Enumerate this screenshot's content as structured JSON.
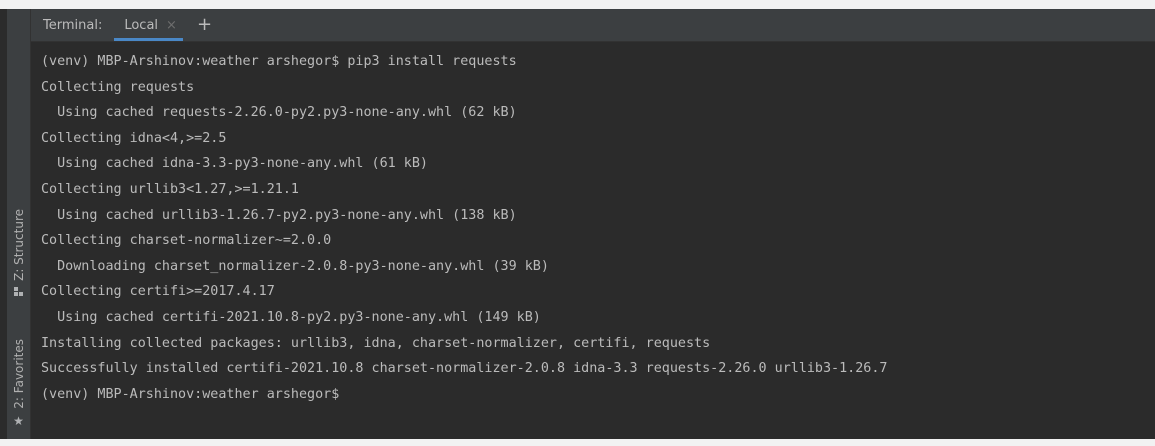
{
  "tabbar": {
    "title": "Terminal:",
    "active_tab": "Local",
    "close_glyph": "×",
    "add_glyph": "+"
  },
  "sidebar": {
    "structure_label": "Z: Structure",
    "favorites_label": "2: Favorites",
    "favorites_icon": "star-icon",
    "structure_icon": "structure-icon"
  },
  "terminal": {
    "lines": [
      "(venv) MBP-Arshinov:weather arshegor$ pip3 install requests",
      "Collecting requests",
      "  Using cached requests-2.26.0-py2.py3-none-any.whl (62 kB)",
      "Collecting idna<4,>=2.5",
      "  Using cached idna-3.3-py3-none-any.whl (61 kB)",
      "Collecting urllib3<1.27,>=1.21.1",
      "  Using cached urllib3-1.26.7-py2.py3-none-any.whl (138 kB)",
      "Collecting charset-normalizer~=2.0.0",
      "  Downloading charset_normalizer-2.0.8-py3-none-any.whl (39 kB)",
      "Collecting certifi>=2017.4.17",
      "  Using cached certifi-2021.10.8-py2.py3-none-any.whl (149 kB)",
      "Installing collected packages: urllib3, idna, charset-normalizer, certifi, requests",
      "Successfully installed certifi-2021.10.8 charset-normalizer-2.0.8 idna-3.3 requests-2.26.0 urllib3-1.26.7",
      "(venv) MBP-Arshinov:weather arshegor$"
    ]
  },
  "colors": {
    "background": "#2b2b2b",
    "panel": "#3c3f41",
    "text": "#bbbbbb",
    "accent": "#4a88c7"
  }
}
